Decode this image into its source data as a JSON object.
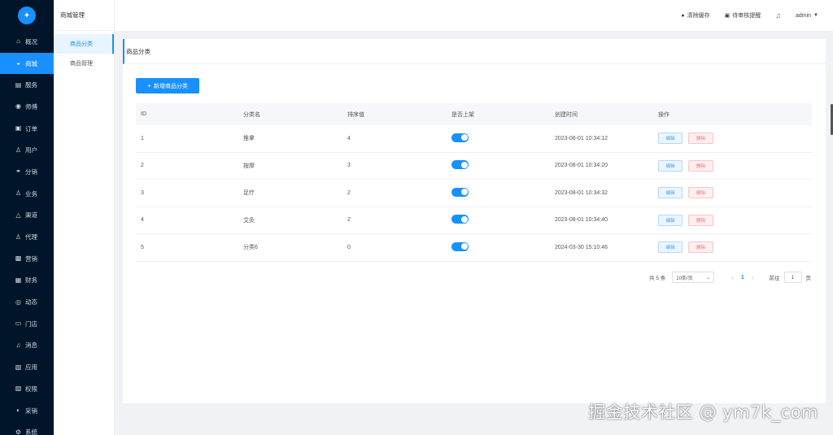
{
  "sidebar": {
    "items": [
      {
        "label": "概况",
        "icon": "home-icon",
        "glyph": "⌂"
      },
      {
        "label": "商城",
        "icon": "shop-bag-icon",
        "glyph": "◒"
      },
      {
        "label": "服务",
        "icon": "service-icon",
        "glyph": "▤"
      },
      {
        "label": "师傅",
        "icon": "worker-icon",
        "glyph": "◉"
      },
      {
        "label": "订单",
        "icon": "order-icon",
        "glyph": "▣"
      },
      {
        "label": "用户",
        "icon": "user-icon",
        "glyph": "♙"
      },
      {
        "label": "分销",
        "icon": "distribution-icon",
        "glyph": "⚭"
      },
      {
        "label": "业务",
        "icon": "business-icon",
        "glyph": "♙"
      },
      {
        "label": "渠道",
        "icon": "channel-icon",
        "glyph": "△"
      },
      {
        "label": "代理",
        "icon": "agent-icon",
        "glyph": "♙"
      },
      {
        "label": "营销",
        "icon": "marketing-icon",
        "glyph": "▩"
      },
      {
        "label": "财务",
        "icon": "finance-icon",
        "glyph": "▦"
      },
      {
        "label": "动态",
        "icon": "dynamic-icon",
        "glyph": "◎"
      },
      {
        "label": "门店",
        "icon": "store-icon",
        "glyph": "▭"
      },
      {
        "label": "消息",
        "icon": "bell-icon",
        "glyph": "♫"
      },
      {
        "label": "应用",
        "icon": "app-icon",
        "glyph": "▧"
      },
      {
        "label": "权限",
        "icon": "permission-icon",
        "glyph": "▨"
      },
      {
        "label": "采销",
        "icon": "purchase-icon",
        "glyph": "◐"
      },
      {
        "label": "系统",
        "icon": "system-icon",
        "glyph": "⚙"
      }
    ],
    "active_index": 1
  },
  "submenu": {
    "title": "商城管理",
    "items": [
      "商品分类",
      "商品管理"
    ]
  },
  "header": {
    "clear_cache": "清除缓存",
    "notify": "待审核提醒",
    "user": "admin"
  },
  "card": {
    "title": "商品分类",
    "add_button": "新增商品分类"
  },
  "table": {
    "headers": [
      "ID",
      "分类名",
      "排序值",
      "是否上架",
      "创建时间",
      "操作"
    ],
    "rows": [
      {
        "id": "1",
        "name": "推拿",
        "sort": "4",
        "date": "2023-08-01 10:34:12",
        "enabled": true
      },
      {
        "id": "2",
        "name": "按摩",
        "sort": "3",
        "date": "2023-08-01 10:34:20",
        "enabled": true
      },
      {
        "id": "3",
        "name": "足疗",
        "sort": "2",
        "date": "2023-08-01 10:34:32",
        "enabled": true
      },
      {
        "id": "4",
        "name": "艾灸",
        "sort": "2",
        "date": "2023-08-01 10:34:40",
        "enabled": true
      },
      {
        "id": "5",
        "name": "分类6",
        "sort": "0",
        "date": "2024-03-30 15:10:46",
        "enabled": true
      }
    ],
    "edit_label": "编辑",
    "delete_label": "删除"
  },
  "pager": {
    "total": "共 5 条",
    "page_size": "10条/页",
    "current": "1",
    "goto": "前往",
    "goto_value": "1",
    "page_unit": "页"
  },
  "watermark": "掘金技术社区 @ ym7k_com",
  "colors": {
    "primary": "#1890ff",
    "sidebar_bg": "#001529",
    "danger": "#f56c6c"
  }
}
